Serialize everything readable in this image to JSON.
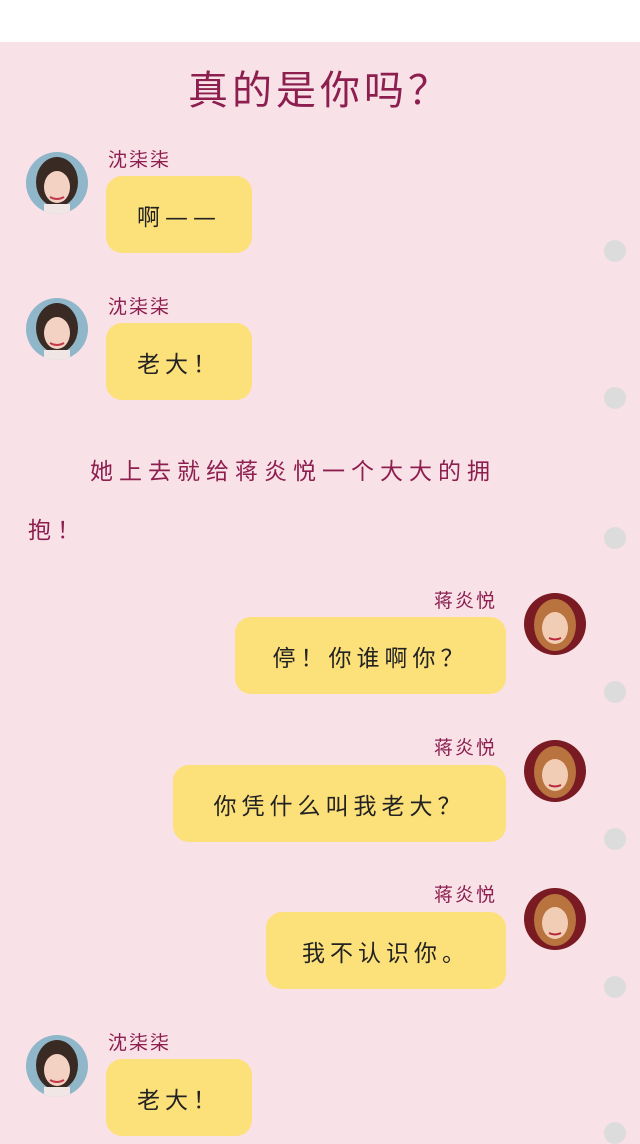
{
  "header": {
    "title": "真的是你吗？"
  },
  "chat": {
    "m1": {
      "sender": "沈柒柒",
      "text": "啊——"
    },
    "m2": {
      "sender": "沈柒柒",
      "text": "老大！"
    },
    "narration": {
      "line1": "她上去就给蒋炎悦一个大大的拥",
      "line2": "抱！"
    },
    "m3": {
      "sender": "蒋炎悦",
      "text": "停！你谁啊你？"
    },
    "m4": {
      "sender": "蒋炎悦",
      "text": "你凭什么叫我老大？"
    },
    "m5": {
      "sender": "蒋炎悦",
      "text": "我不认识你。"
    },
    "m6": {
      "sender": "沈柒柒",
      "text": "老大！"
    }
  },
  "colors": {
    "background": "#f9e1e8",
    "bubble": "#fce07a",
    "accent_text": "#8c1f4e",
    "side_dot": "#dcdcdc"
  }
}
